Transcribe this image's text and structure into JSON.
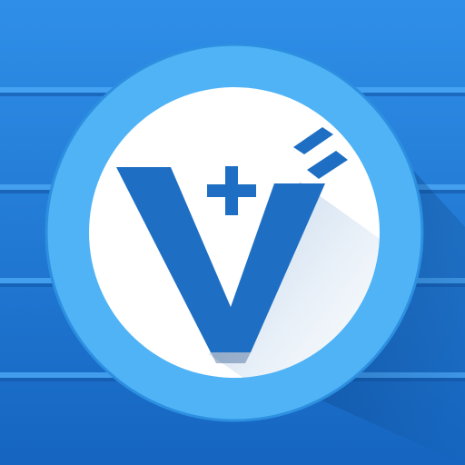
{
  "icon": {
    "name": "v-plus-logo-app-icon",
    "glyph": "V+",
    "colors": {
      "background_top": "#2f8fe8",
      "background_bottom": "#1565c0",
      "stripe_light": "#4aa6f3",
      "stripe_dark": "#1256a8",
      "ring": "#4fb3f6",
      "ring_edge": "#2c8fe0",
      "disc": "#ffffff",
      "mark": "#1e6fc4",
      "mark_shadow": "#0d3f7a"
    }
  }
}
